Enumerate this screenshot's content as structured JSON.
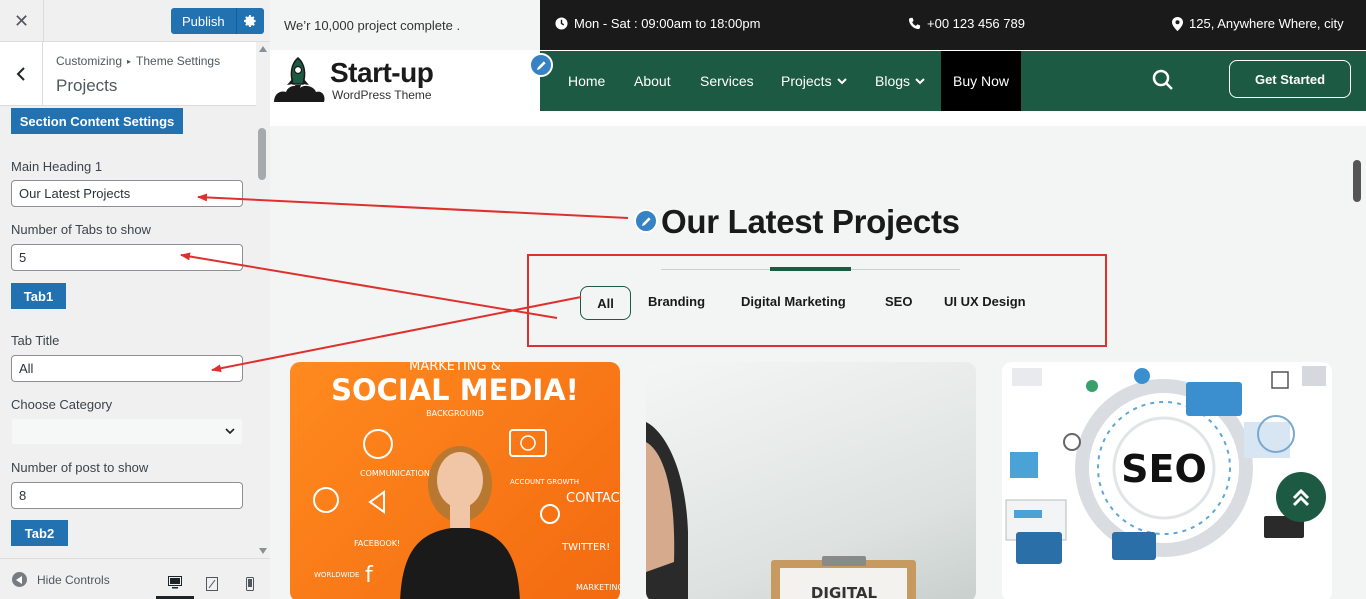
{
  "customizer": {
    "close_label": "✕",
    "publish_label": "Publish",
    "breadcrumb": [
      "Customizing",
      "Theme Settings"
    ],
    "section_title": "Projects",
    "section_button": "Section Content Settings",
    "fields": {
      "main_heading_label": "Main Heading 1",
      "main_heading_value": "Our Latest Projects",
      "tabs_count_label": "Number of Tabs to show",
      "tabs_count_value": "5",
      "tab1_label": "Tab1",
      "tab_title_label": "Tab Title",
      "tab_title_value": "All",
      "category_label": "Choose Category",
      "category_value": "",
      "posts_count_label": "Number of post to show",
      "posts_count_value": "8",
      "tab2_label": "Tab2"
    },
    "footer": {
      "hide_controls": "Hide Controls"
    }
  },
  "site": {
    "topbar": {
      "tagline": "We’r 10,000 project complete .",
      "hours": "Mon - Sat : 09:00am to 18:00pm",
      "phone": "+00 123 456 789",
      "address": "125, Anywhere Where, city"
    },
    "logo": {
      "title": "Start-up",
      "subtitle": "WordPress Theme"
    },
    "nav": [
      "Home",
      "About",
      "Services",
      "Projects",
      "Blogs",
      "Buy Now"
    ],
    "cta": "Get Started",
    "heading": "Our Latest Projects",
    "tabs": [
      "All",
      "Branding",
      "Digital Marketing",
      "SEO",
      "UI UX Design"
    ],
    "cards": {
      "card1_top": "MARKETING &",
      "card1_title": "SOCIAL MEDIA!",
      "card1_sub": "BACKGROUND",
      "card1_tags": [
        "COMMUNICATION",
        "ACCOUNT GROWTH",
        "CONTACT",
        "FACEBOOK!",
        "TWITTER!",
        "WORLDWIDE",
        "MARKETING"
      ],
      "card2_sign": "DIGITAL",
      "card3_title": "SEO"
    }
  },
  "colors": {
    "brand_green": "#1d5a43",
    "wp_blue": "#2271b1",
    "annotation_red": "#e0302e"
  }
}
